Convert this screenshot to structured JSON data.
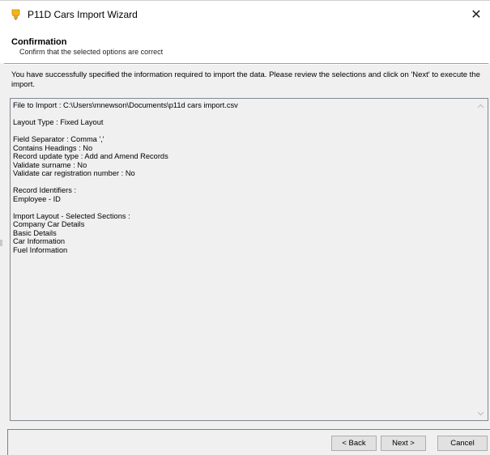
{
  "window": {
    "title": "P11D Cars Import Wizard",
    "close_glyph": "✕"
  },
  "header": {
    "title": "Confirmation",
    "subtitle": "Confirm that the selected options are correct"
  },
  "intro": "You have successfully specified the information required to import the data. Please review the selections and click on 'Next' to execute the import.",
  "summary": {
    "lines": [
      "File to Import : C:\\Users\\mnewson\\Documents\\p11d cars import.csv",
      "",
      "Layout Type : Fixed Layout",
      "",
      "Field Separator : Comma ','",
      "Contains Headings : No",
      "Record update type : Add and Amend Records",
      "Validate surname : No",
      "Validate car registration number : No",
      "",
      "Record Identifiers :",
      "Employee - ID",
      "",
      "Import Layout - Selected Sections :",
      "Company Car Details",
      "Basic Details",
      "Car Information",
      "Fuel Information"
    ]
  },
  "buttons": {
    "back": "< Back",
    "next": "Next >",
    "cancel": "Cancel"
  },
  "colors": {
    "icon_yellow": "#f2b61b",
    "icon_shadow": "#c68a0a",
    "border": "#828790"
  }
}
